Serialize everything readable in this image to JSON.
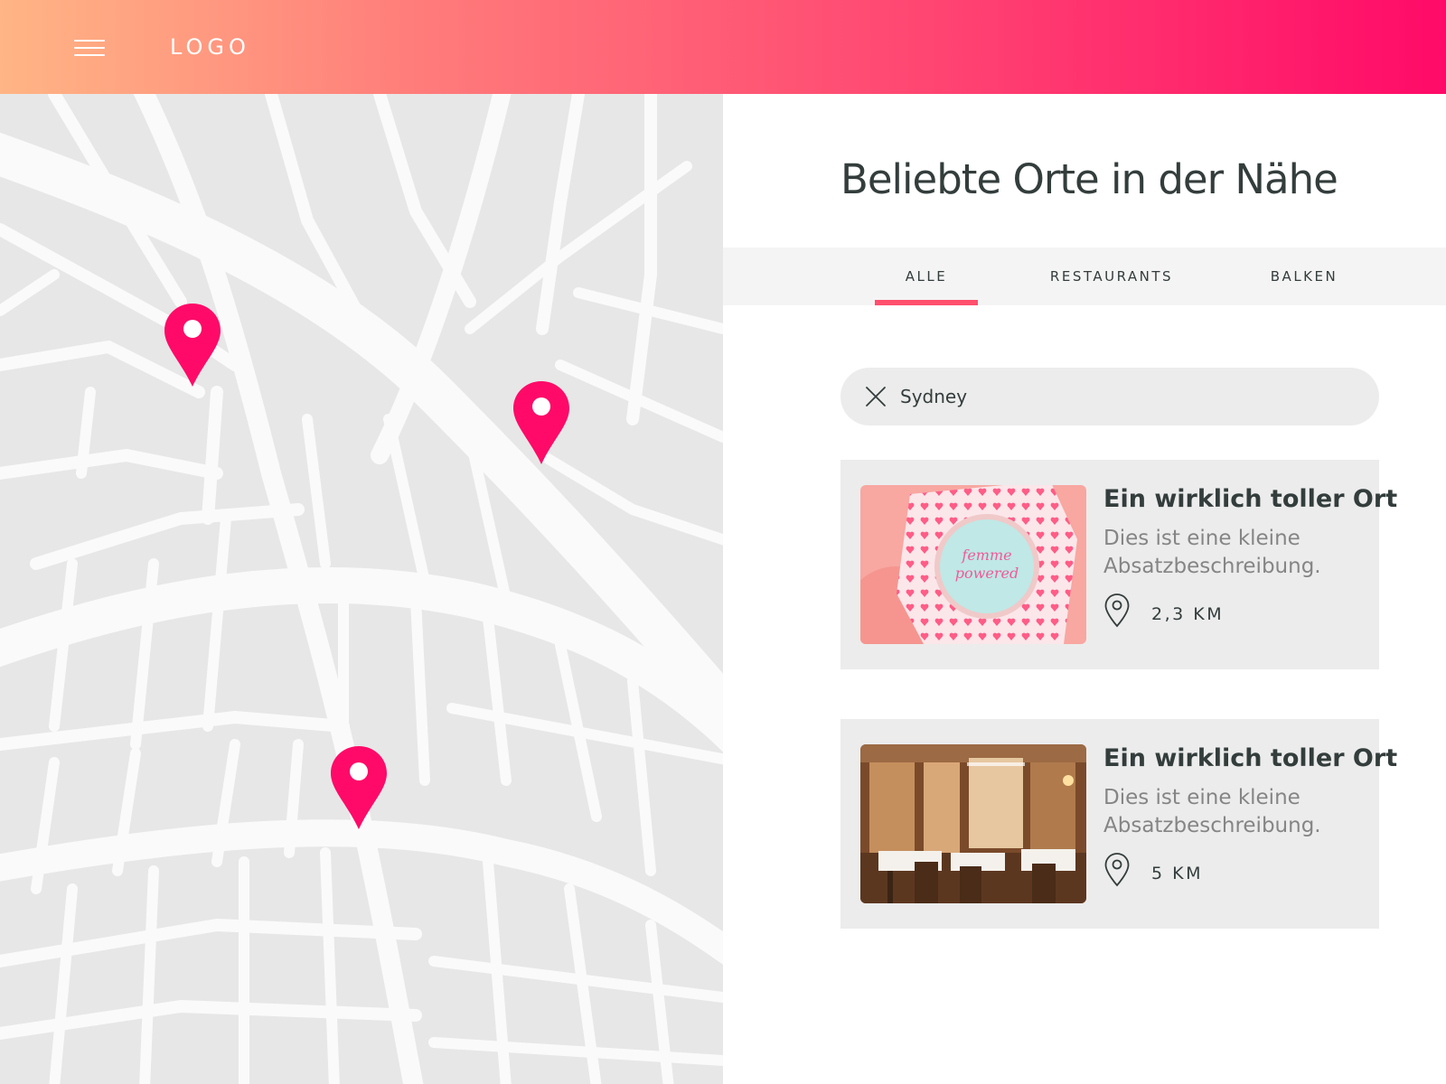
{
  "header": {
    "logo": "LOGO",
    "menu_icon": "hamburger-menu-icon",
    "gradient": [
      "#ffb585",
      "#ff7a7a",
      "#ff4472",
      "#ff0a68"
    ]
  },
  "map": {
    "pin_color": "#ff0a68",
    "pin_icon": "map-pin-icon",
    "pin_count": 3
  },
  "panel": {
    "title": "Beliebte Orte in der Nähe",
    "tabs": [
      {
        "label": "ALLE",
        "active": true
      },
      {
        "label": "RESTAURANTS",
        "active": false
      },
      {
        "label": "BALKEN",
        "active": false
      }
    ],
    "accent": "#ff4f6e"
  },
  "search": {
    "value": "Sydney",
    "clear_icon": "close-icon"
  },
  "cards": [
    {
      "title": "Ein wirklich toller Ort",
      "description": "Dies ist eine kleine Absatzbeschreibung.",
      "distance": "2,3 KM",
      "icon": "location-pin-outline-icon",
      "image": "cake-photo"
    },
    {
      "title": "Ein wirklich toller Ort",
      "description": "Dies ist eine kleine Absatzbeschreibung.",
      "distance": "5 KM",
      "icon": "location-pin-outline-icon",
      "image": "restaurant-interior-photo"
    }
  ]
}
